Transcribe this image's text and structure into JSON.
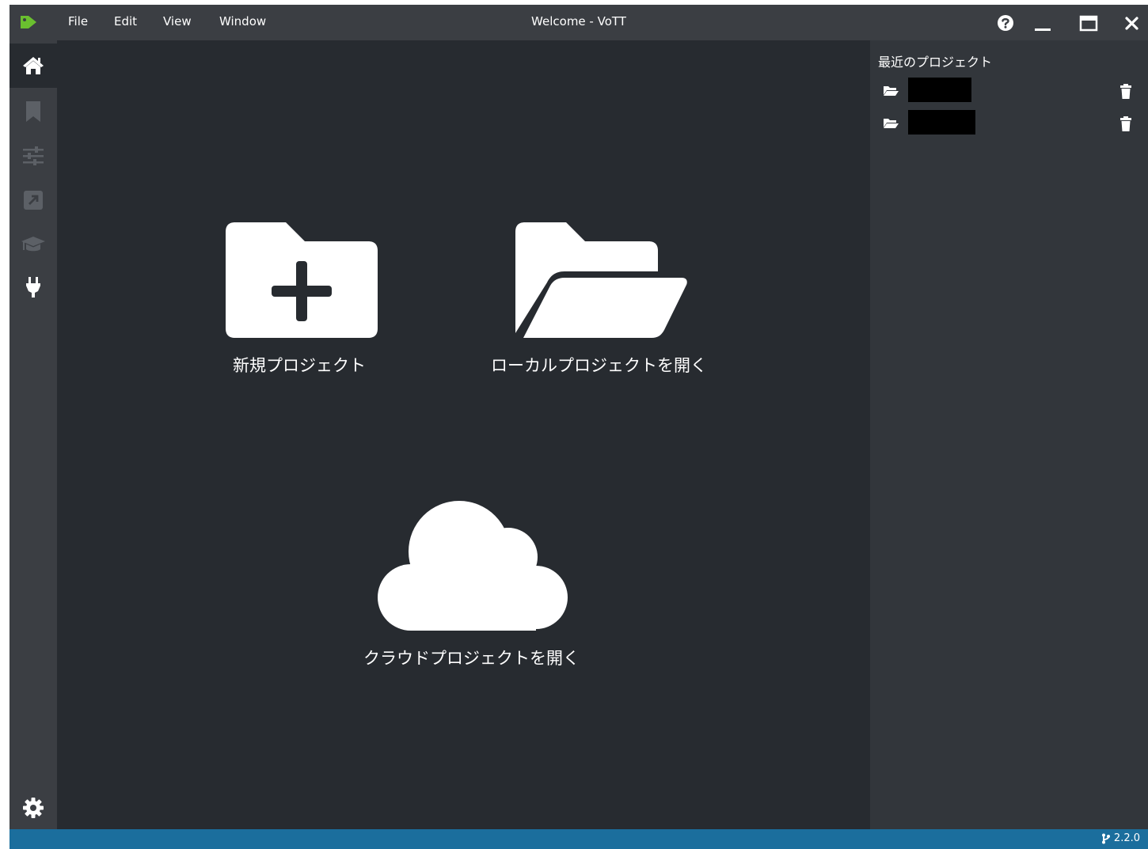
{
  "window": {
    "title": "Welcome - VoTT",
    "menu": [
      "File",
      "Edit",
      "View",
      "Window"
    ]
  },
  "sidebar": {
    "items": [
      {
        "icon": "home-icon",
        "active": true
      },
      {
        "icon": "bookmark-icon"
      },
      {
        "icon": "sliders-icon"
      },
      {
        "icon": "export-icon"
      },
      {
        "icon": "graduation-cap-icon"
      },
      {
        "icon": "plug-icon"
      }
    ],
    "bottom_icon": "gear-icon"
  },
  "main": {
    "new_project": "新規プロジェクト",
    "open_local": "ローカルプロジェクトを開く",
    "open_cloud": "クラウドプロジェクトを開く"
  },
  "recent": {
    "title": "最近のプロジェクト",
    "items": [
      {
        "name": "",
        "redacted": true
      },
      {
        "name": "",
        "redacted": true
      }
    ]
  },
  "status": {
    "version": "2.2.0"
  },
  "colors": {
    "accent": "#1b6e9d",
    "logo": "#6abf2f",
    "background": "#272b30",
    "panel": "#32363b",
    "bar": "#3b3e43"
  }
}
